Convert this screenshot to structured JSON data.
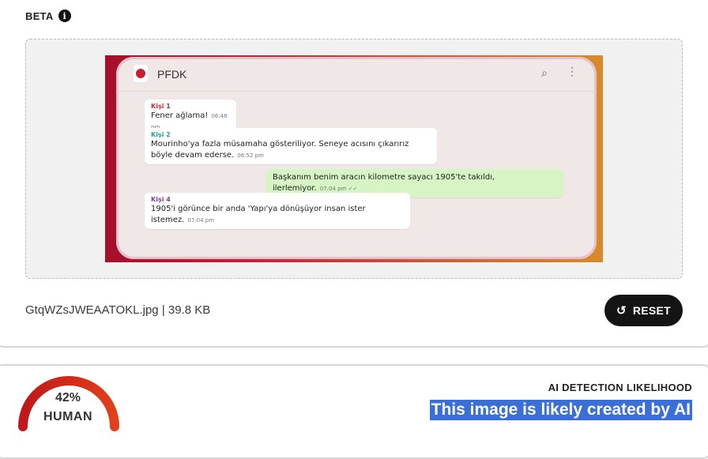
{
  "header": {
    "beta_label": "BETA",
    "info_icon": "info-icon"
  },
  "preview": {
    "app_title": "PFDK",
    "messages": [
      {
        "sender": "Kişi 1",
        "sender_color": "#d0243a",
        "text": "Fener ağlama!",
        "time": "06:48 pm"
      },
      {
        "sender": "Kişi 2",
        "sender_color": "#1aa88a",
        "text": "Mourinho'ya fazla müsamaha gösteriliyor. Seneye acısını çıkarırız böyle devam ederse.",
        "time": "06:52 pm"
      },
      {
        "sender": "",
        "text": "Başkanım benim aracın kilometre sayacı 1905'te takıldı, ilerlemiyor.",
        "time": "07:04 pm ✓✓"
      },
      {
        "sender": "Kişi 4",
        "sender_color": "#7a3aa8",
        "text": "1905'i görünce bir anda 'Yapı'ya dönüşüyor insan ister istemez.",
        "time": "07:04 pm"
      }
    ]
  },
  "file": {
    "info": "GtqWZsJWEAATOKL.jpg | 39.8 KB"
  },
  "reset": {
    "label": "RESET",
    "icon": "reset-icon"
  },
  "result": {
    "percent": "42%",
    "percent_value": 42,
    "label": "HUMAN",
    "title": "AI DETECTION LIKELIHOOD",
    "verdict": "This image is likely created by AI"
  },
  "colors": {
    "gauge_start": "#c0181b",
    "gauge_end": "#e0401a",
    "highlight": "#3b6fd8",
    "button": "#141414"
  }
}
